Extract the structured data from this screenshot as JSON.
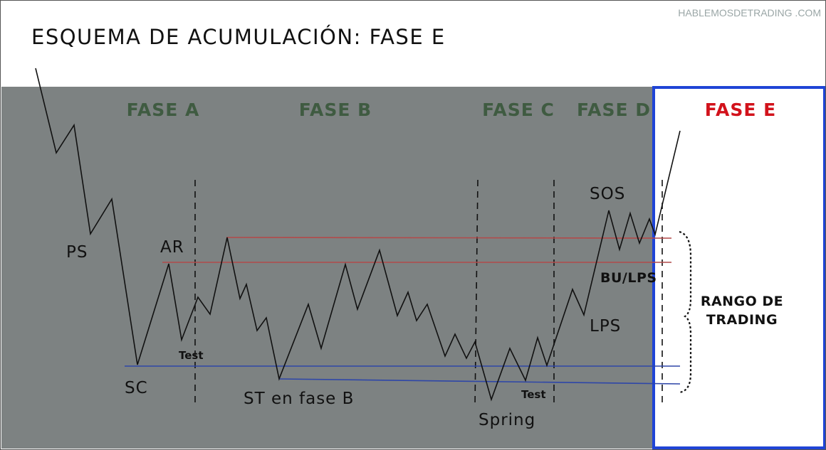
{
  "header": {
    "title": "ESQUEMA DE ACUMULACIÓN: FASE E",
    "watermark": "HABLEMOSDETRADING .COM"
  },
  "phases": [
    {
      "id": "a",
      "label": "FASE A"
    },
    {
      "id": "b",
      "label": "FASE B"
    },
    {
      "id": "c",
      "label": "FASE C"
    },
    {
      "id": "d",
      "label": "FASE D"
    },
    {
      "id": "e",
      "label": "FASE E"
    }
  ],
  "events": {
    "ps": "PS",
    "sc": "SC",
    "ar": "AR",
    "test1": "Test",
    "st": "ST en fase B",
    "spring": "Spring",
    "test2": "Test",
    "sos": "SOS",
    "lps": "LPS",
    "bu_lps": "BU/LPS"
  },
  "range_label": [
    "RANGO DE",
    "TRADING"
  ],
  "colors": {
    "panel": "#7d8282",
    "phase_label": "#3f5b41",
    "phase_e_label": "#d2121b",
    "phase_e_border": "#1f44d6",
    "resistance": "#b24a4a",
    "support": "#2e46a8",
    "price": "#111111"
  }
}
